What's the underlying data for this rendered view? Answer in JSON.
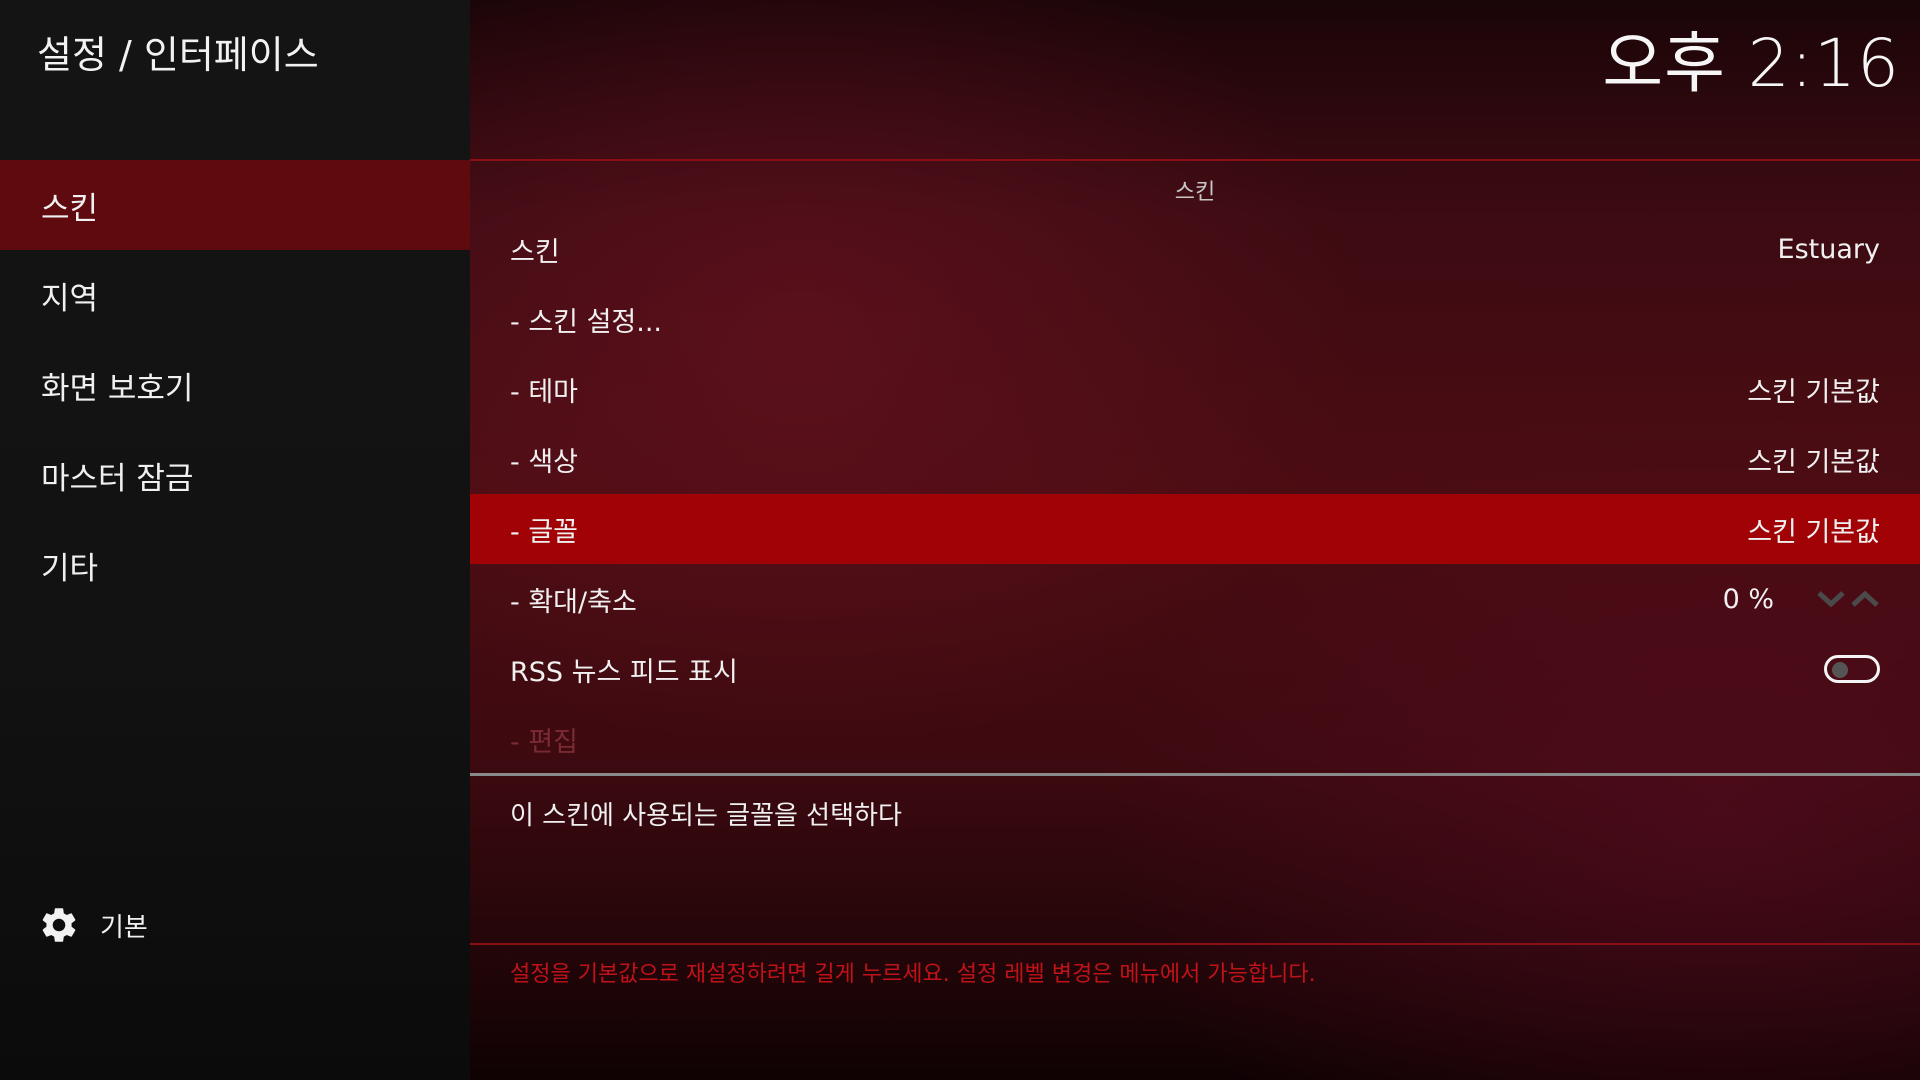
{
  "header": {
    "breadcrumb": "설정 / 인터페이스",
    "clock": "오후 2:16"
  },
  "sidebar": {
    "items": [
      {
        "label": "스킨",
        "active": true
      },
      {
        "label": "지역"
      },
      {
        "label": "화면 보호기"
      },
      {
        "label": "마스터 잠금"
      },
      {
        "label": "기타"
      }
    ],
    "footer": {
      "icon": "gear-icon",
      "label": "기본"
    }
  },
  "main": {
    "section_title": "스킨",
    "rows": [
      {
        "label": "스킨",
        "value": "Estuary"
      },
      {
        "label": "- 스킨 설정..."
      },
      {
        "label": "- 테마",
        "value": "스킨 기본값"
      },
      {
        "label": "- 색상",
        "value": "스킨 기본값"
      },
      {
        "label": "- 글꼴",
        "value": "스킨 기본값",
        "focused": true
      },
      {
        "label": "- 확대/축소",
        "value": "0 %",
        "control": "spinner"
      },
      {
        "label": "RSS 뉴스 피드 표시",
        "control": "toggle",
        "state": "off"
      },
      {
        "label": "- 편집",
        "disabled": true
      }
    ],
    "description": "이 스킨에 사용되는 글꼴을 선택하다",
    "hint": "설정을 기본값으로 재설정하려면 길게 누르세요. 설정 레벨 변경은 메뉴에서 가능합니다."
  },
  "colors": {
    "accent": "#a10205",
    "active_nav": "#5e0a0e",
    "hint": "#c01218"
  }
}
